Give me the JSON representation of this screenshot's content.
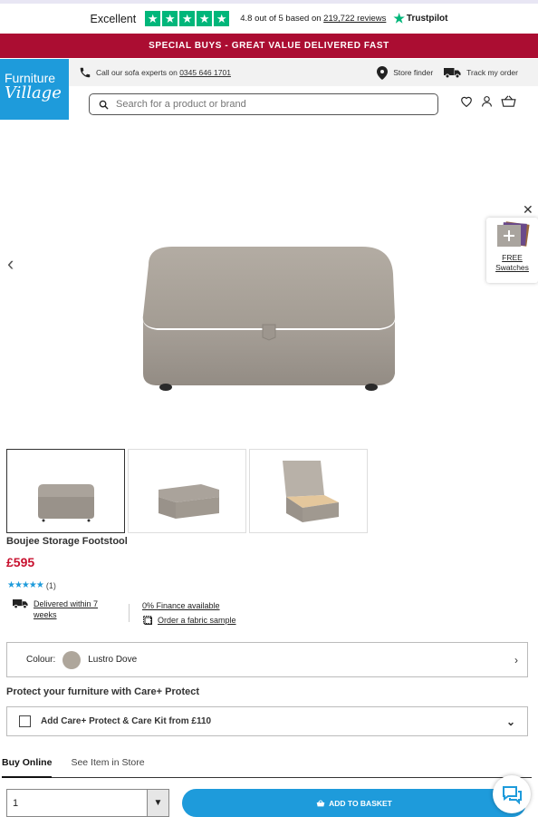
{
  "trustpilot": {
    "excellent": "Excellent",
    "rating_text": "4.8 out of 5 based on",
    "reviews": "219,722 reviews",
    "brand": "Trustpilot",
    "star_glyph": "★"
  },
  "promo": {
    "text": "SPECIAL BUYS - GREAT VALUE DELIVERED FAST"
  },
  "logo": {
    "line1": "Furniture",
    "line2": "Village"
  },
  "utility": {
    "call_prefix": "Call our",
    "call_bold": "sofa experts",
    "call_on": "on",
    "phone": "0345 646 1701",
    "store_finder": "Store finder",
    "track": "Track my order"
  },
  "search": {
    "placeholder": "Search for a product or brand"
  },
  "swatch": {
    "label1": "FREE",
    "label2": "Swatches"
  },
  "product": {
    "title": "Boujee Storage Footstool",
    "price": "£595",
    "review_count": "(1)",
    "rating": 5
  },
  "delivery": {
    "line1": "Delivered within 7",
    "line2": "weeks"
  },
  "finance": {
    "text": "0% Finance available",
    "sample": "Order a fabric sample"
  },
  "colour": {
    "label": "Colour:",
    "value": "Lustro Dove",
    "swatch_hex": "#aea69b"
  },
  "protect": {
    "heading": "Protect your furniture with Care+ Protect",
    "option": "Add Care+ Protect & Care Kit from £110"
  },
  "tabs": [
    {
      "label": "Buy Online"
    },
    {
      "label": "See Item in Store"
    }
  ],
  "quantity": {
    "value": "1"
  },
  "basket": {
    "label": "ADD TO BASKET"
  },
  "colors": {
    "brand_blue": "#1e9bdb",
    "promo_red": "#ab0d32",
    "price_red": "#c8102e",
    "trustpilot_green": "#00b67a"
  }
}
